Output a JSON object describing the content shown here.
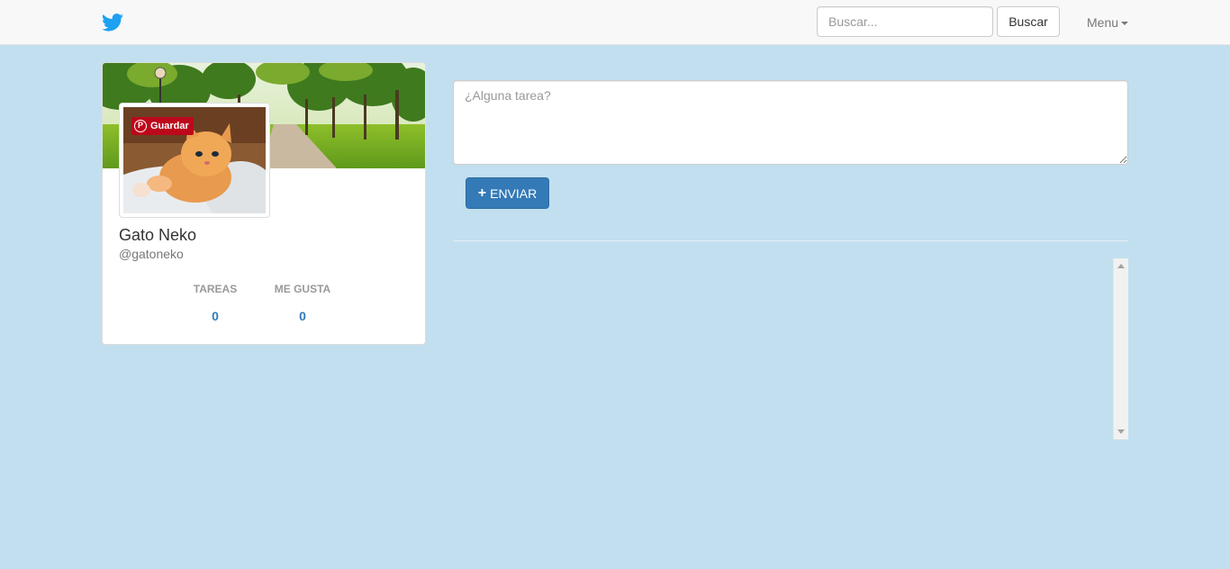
{
  "navbar": {
    "logo_icon": "twitter-bird-icon",
    "search_placeholder": "Buscar...",
    "search_button": "Buscar",
    "menu_label": "Menu"
  },
  "profile": {
    "name": "Gato Neko",
    "handle": "@gatoneko",
    "pin_button": "Guardar",
    "stats": [
      {
        "label": "TAREAS",
        "value": "0"
      },
      {
        "label": "ME GUSTA",
        "value": "0"
      }
    ]
  },
  "compose": {
    "placeholder": "¿Alguna tarea?",
    "send_button": "ENVIAR"
  },
  "colors": {
    "background": "#c2dfef",
    "primary": "#337ab7",
    "twitter_blue": "#1da1f2",
    "pinterest_red": "#bd081c"
  }
}
